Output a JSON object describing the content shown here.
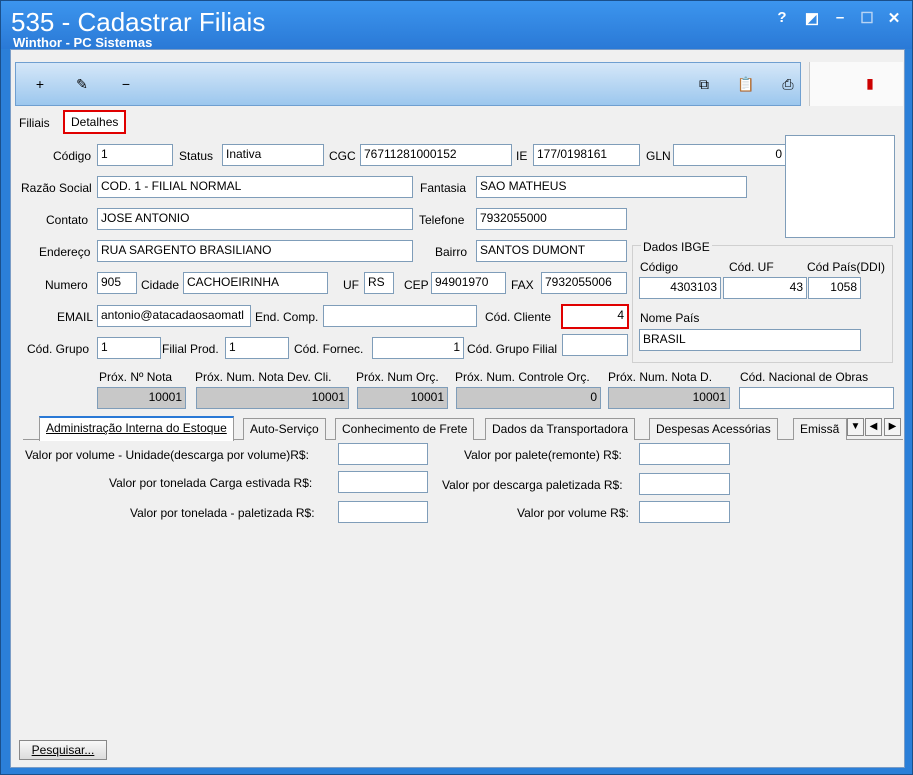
{
  "window": {
    "title": "535 - Cadastrar Filiais",
    "subtitle": "Winthor - PC Sistemas"
  },
  "top_tabs": [
    "Filiais",
    "Detalhes"
  ],
  "form": {
    "codigo_label": "Código",
    "codigo": "1",
    "status_label": "Status",
    "status": "Inativa",
    "cgc_label": "CGC",
    "cgc": "76711281000152",
    "ie_label": "IE",
    "ie": "177/0198161",
    "gln_label": "GLN",
    "gln": "0",
    "razao_label": "Razão Social",
    "razao": "COD. 1 - FILIAL NORMAL",
    "fantasia_label": "Fantasia",
    "fantasia": "SAO MATHEUS",
    "contato_label": "Contato",
    "contato": "JOSE ANTONIO",
    "telefone_label": "Telefone",
    "telefone": "7932055000",
    "endereco_label": "Endereço",
    "endereco": "RUA SARGENTO BRASILIANO",
    "bairro_label": "Bairro",
    "bairro": "SANTOS DUMONT",
    "numero_label": "Numero",
    "numero": "905",
    "cidade_label": "Cidade",
    "cidade": "CACHOEIRINHA",
    "uf_label": "UF",
    "uf": "RS",
    "cep_label": "CEP",
    "cep": "94901970",
    "fax_label": "FAX",
    "fax": "7932055006",
    "email_label": "EMAIL",
    "email": "antonio@atacadaosaomatl",
    "endcomp_label": "End. Comp.",
    "endcomp": "",
    "codcliente_label": "Cód. Cliente",
    "codcliente": "4",
    "codgrupo_label": "Cód. Grupo",
    "codgrupo": "1",
    "filialprod_label": "Filial Prod.",
    "filialprod": "1",
    "codfornec_label": "Cód. Fornec.",
    "codfornec": "1",
    "codgrupofilial_label": "Cód. Grupo Filial",
    "codgrupofilial": ""
  },
  "ibge": {
    "group_label": "Dados IBGE",
    "codigo_label": "Código",
    "codigo": "4303103",
    "coduf_label": "Cód. UF",
    "coduf": "43",
    "codpais_label": "Cód País(DDI)",
    "codpais": "1058",
    "nomepais_label": "Nome País",
    "nomepais": "BRASIL"
  },
  "prox": {
    "nota_label": "Próx. Nº Nota",
    "nota": "10001",
    "notadev_label": "Próx. Num. Nota Dev. Cli.",
    "notadev": "10001",
    "orc_label": "Próx. Num Orç.",
    "orc": "10001",
    "controle_label": "Próx. Num. Controle Orç.",
    "controle": "0",
    "notad_label": "Próx. Num. Nota D.",
    "notad": "10001",
    "obras_label": "Cód. Nacional de Obras",
    "obras": ""
  },
  "sub_tabs": [
    "Administração Interna do Estoque",
    "Auto-Serviço",
    "Conhecimento de Frete",
    "Dados da Transportadora",
    "Despesas Acessórias",
    "Emissã"
  ],
  "estoque": {
    "vol_unid_label": "Valor por volume - Unidade(descarga por volume)R$:",
    "ton_estivada_label": "Valor por tonelada Carga estivada R$:",
    "ton_paletizada_label": "Valor por tonelada - paletizada R$:",
    "palete_label": "Valor por palete(remonte) R$:",
    "descarga_pal_label": "Valor por descarga paletizada R$:",
    "volume_label": "Valor por volume R$:"
  },
  "search_button": "Pesquisar..."
}
